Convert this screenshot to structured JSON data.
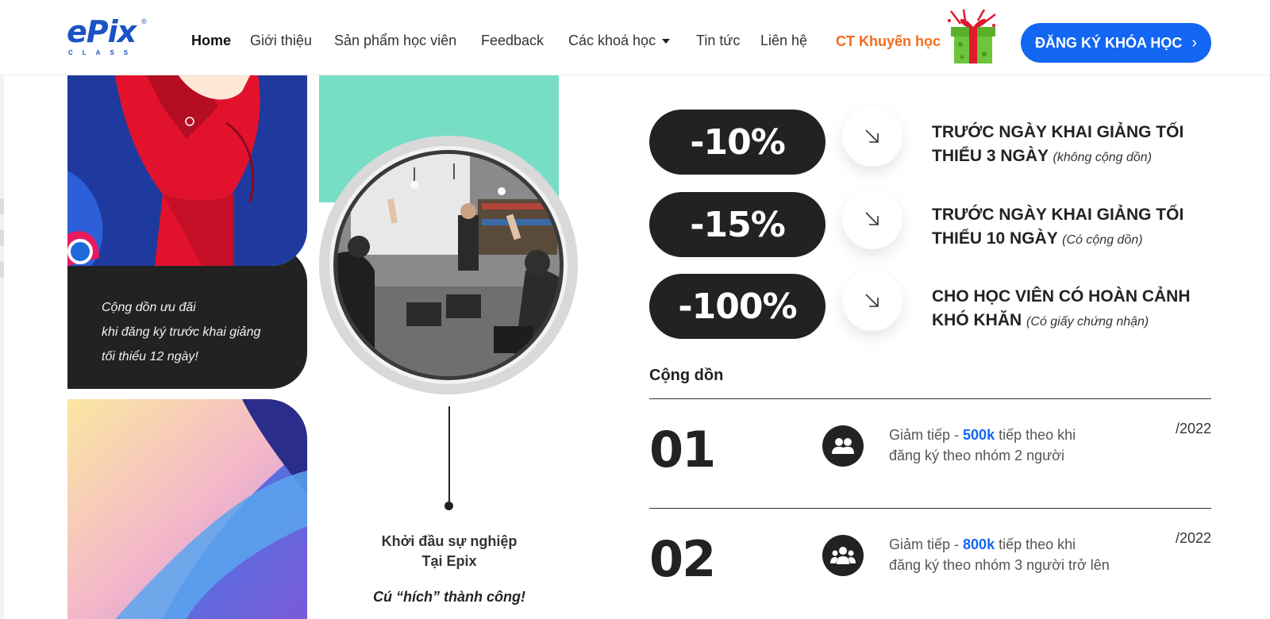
{
  "header": {
    "logo": {
      "main": "ePix",
      "sub": "CLASS"
    },
    "nav": [
      {
        "label": "Home",
        "active": true
      },
      {
        "label": "Giới thiệu"
      },
      {
        "label": "Sản phẩm học viên"
      },
      {
        "label": "Feedback"
      },
      {
        "label": "Các khoá học",
        "dropdown": true
      },
      {
        "label": "Tin tức"
      },
      {
        "label": "Liên hệ"
      }
    ],
    "promo_label": "CT Khuyến học",
    "cta_label": "ĐĂNG KÝ KHÓA HỌC"
  },
  "left": {
    "quote_lines": [
      "Cộng dồn ưu đãi",
      "khi đăng ký trước khai giảng",
      "tối thiểu 12 ngày!"
    ],
    "career_lines": [
      "Khởi đầu sự nghiệp",
      "Tại Epix"
    ],
    "slogan": "Cú “hích” thành công!"
  },
  "discounts": [
    {
      "percent": "-10%",
      "text_lines": [
        "TRƯỚC NGÀY KHAI GIẢNG TỐI",
        "THIỂU 3 NGÀY"
      ],
      "note": "(không cộng dồn)"
    },
    {
      "percent": "-15%",
      "text_lines": [
        "TRƯỚC NGÀY KHAI GIẢNG TỐI",
        "THIỂU 10 NGÀY"
      ],
      "note": "(Có cộng dồn)"
    },
    {
      "percent": "-100%",
      "text_lines": [
        "CHO HỌC VIÊN CÓ HOÀN CẢNH",
        "KHÓ KHĂN"
      ],
      "note": "(Có giấy chứng nhận)"
    }
  ],
  "cumulative": {
    "title": "Cộng dồn",
    "tiers": [
      {
        "number": "01",
        "prefix": "Giảm tiếp - ",
        "amount": "500k",
        "suffix": " tiếp theo khi",
        "line2": "đăng ký theo nhóm 2 người",
        "date": "/2022",
        "icon": "group-2-icon"
      },
      {
        "number": "02",
        "prefix": "Giảm tiếp - ",
        "amount": "800k",
        "suffix": " tiếp theo khi",
        "line2": "đăng ký theo nhóm 3 người trở lên",
        "date": "/2022",
        "icon": "group-3-icon"
      }
    ]
  },
  "colors": {
    "accent": "#1266f1",
    "promo": "#f26b1d",
    "dark": "#222222",
    "teal": "#77dec5"
  }
}
